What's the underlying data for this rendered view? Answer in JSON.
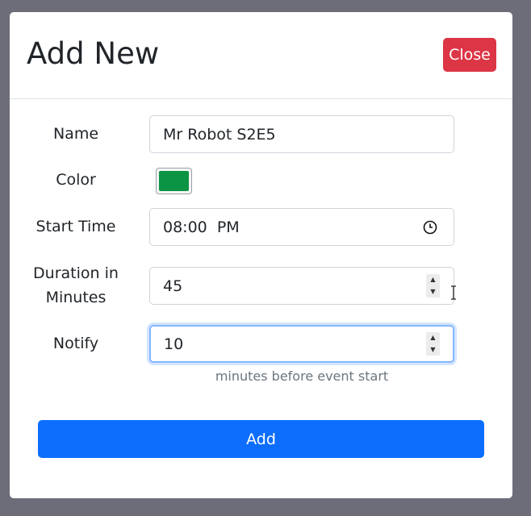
{
  "modal": {
    "title": "Add New",
    "close_label": "Close"
  },
  "form": {
    "name": {
      "label": "Name",
      "value": "Mr Robot S2E5"
    },
    "color": {
      "label": "Color",
      "value": "#0b9444"
    },
    "start_time": {
      "label": "Start Time",
      "value": "08:00  PM",
      "icon": "clock-icon"
    },
    "duration": {
      "label_line1": "Duration in",
      "label_line2": "Minutes",
      "value": "45"
    },
    "notify": {
      "label": "Notify",
      "value": "10",
      "hint": "minutes before event start"
    }
  },
  "actions": {
    "add_label": "Add"
  },
  "colors": {
    "overlay": "#6c6d79",
    "danger": "#dc3545",
    "primary": "#0d6efd",
    "focus_ring": "#86b7fe"
  }
}
